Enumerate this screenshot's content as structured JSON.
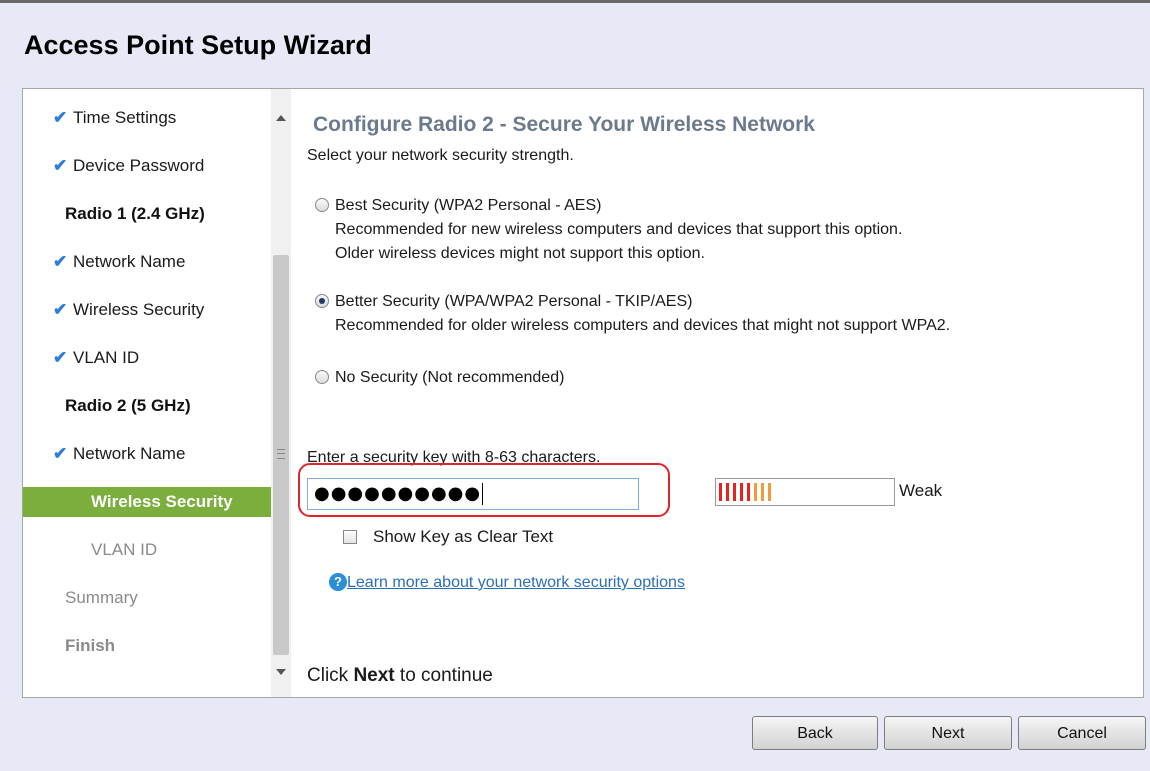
{
  "window": {
    "title": "Access Point Setup Wizard"
  },
  "sidebar": {
    "items": [
      {
        "label": "Time Settings",
        "state": "done"
      },
      {
        "label": "Device Password",
        "state": "done"
      },
      {
        "label": "Radio 1 (2.4 GHz)",
        "state": "heading"
      },
      {
        "label": "Network Name",
        "state": "done"
      },
      {
        "label": "Wireless Security",
        "state": "done"
      },
      {
        "label": "VLAN ID",
        "state": "done"
      },
      {
        "label": "Radio 2 (5 GHz)",
        "state": "heading"
      },
      {
        "label": "Network Name",
        "state": "done"
      },
      {
        "label": "Wireless Security",
        "state": "active"
      },
      {
        "label": "VLAN ID",
        "state": "pending"
      },
      {
        "label": "Summary",
        "state": "pending"
      },
      {
        "label": "Finish",
        "state": "pending"
      }
    ]
  },
  "main": {
    "title": "Configure Radio 2 - Secure Your Wireless Network",
    "subtitle": "Select your network security strength.",
    "options": [
      {
        "label": "Best Security (WPA2 Personal - AES)",
        "desc1": "Recommended for new wireless computers and devices that support this option.",
        "desc2": "Older wireless devices might not support this option.",
        "selected": false
      },
      {
        "label": "Better Security (WPA/WPA2 Personal - TKIP/AES)",
        "desc1": "Recommended for older wireless computers and devices that might not support WPA2.",
        "selected": true
      },
      {
        "label": "No Security (Not recommended)",
        "selected": false
      }
    ],
    "key_label": "Enter a security key with 8-63 characters.",
    "key_value": "●●●●●●●●●●",
    "strength_text": "Weak",
    "strength": {
      "red_bars": 5,
      "orange_bars": 3
    },
    "show_key_label": "Show Key as Clear Text",
    "help_link": "Learn more about your network security options",
    "next_note_prefix": "Click ",
    "next_note_bold": "Next",
    "next_note_suffix": " to continue"
  },
  "buttons": {
    "back": "Back",
    "next": "Next",
    "cancel": "Cancel"
  },
  "colors": {
    "accent_green": "#7bae3c",
    "check_blue": "#2a7fd6",
    "highlight_red": "#e0242b",
    "strength_red": "#e8231f",
    "strength_orange": "#f39a3a"
  },
  "icons": {
    "check": "check-icon",
    "help": "help-icon"
  }
}
